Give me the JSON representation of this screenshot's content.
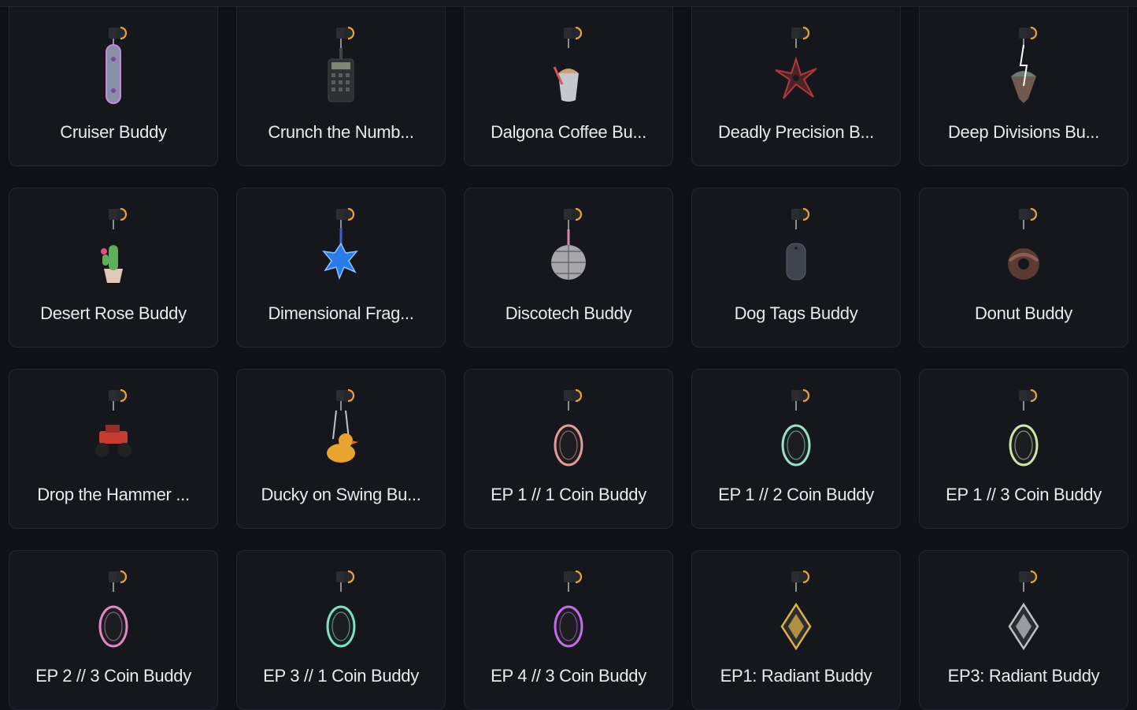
{
  "items": [
    {
      "name": "Cruiser Buddy",
      "icon": "skateboard-icon",
      "color": "#8a8fa8"
    },
    {
      "name": "Crunch the Numb...",
      "icon": "calculator-icon",
      "color": "#2d2f33"
    },
    {
      "name": "Dalgona Coffee Bu...",
      "icon": "coffee-cup-icon",
      "color": "#c9a27a"
    },
    {
      "name": "Deadly Precision B...",
      "icon": "shuriken-icon",
      "color": "#4a2325"
    },
    {
      "name": "Deep Divisions Bu...",
      "icon": "floating-island-icon",
      "color": "#6d7b72"
    },
    {
      "name": "Desert Rose Buddy",
      "icon": "cactus-pot-icon",
      "color": "#5fae5a"
    },
    {
      "name": "Dimensional Frag...",
      "icon": "blue-crystal-icon",
      "color": "#2a7de8"
    },
    {
      "name": "Discotech Buddy",
      "icon": "disco-ball-icon",
      "color": "#a7a7ab"
    },
    {
      "name": "Dog Tags Buddy",
      "icon": "dog-tag-icon",
      "color": "#3f444d"
    },
    {
      "name": "Donut Buddy",
      "icon": "donut-icon",
      "color": "#5a3a32"
    },
    {
      "name": "Drop the Hammer ...",
      "icon": "monster-truck-icon",
      "color": "#c73b33"
    },
    {
      "name": "Ducky on Swing Bu...",
      "icon": "rubber-duck-icon",
      "color": "#e7a52d"
    },
    {
      "name": "EP 1 // 1 Coin Buddy",
      "icon": "coin-icon",
      "color": "#e59999"
    },
    {
      "name": "EP 1 // 2 Coin Buddy",
      "icon": "coin-icon",
      "color": "#98e2c6"
    },
    {
      "name": "EP 1 // 3 Coin Buddy",
      "icon": "coin-icon",
      "color": "#cfe6a6"
    },
    {
      "name": "EP 2 // 3 Coin Buddy",
      "icon": "coin-icon",
      "color": "#e287c7"
    },
    {
      "name": "EP 3 // 1 Coin Buddy",
      "icon": "coin-icon",
      "color": "#7be3c0"
    },
    {
      "name": "EP 4 // 3 Coin Buddy",
      "icon": "coin-icon",
      "color": "#c86be8"
    },
    {
      "name": "EP1: Radiant Buddy",
      "icon": "radiant-diamond-icon",
      "color": "#e0b24a"
    },
    {
      "name": "EP3: Radiant Buddy",
      "icon": "radiant-diamond-icon",
      "color": "#bfc2c7"
    }
  ]
}
